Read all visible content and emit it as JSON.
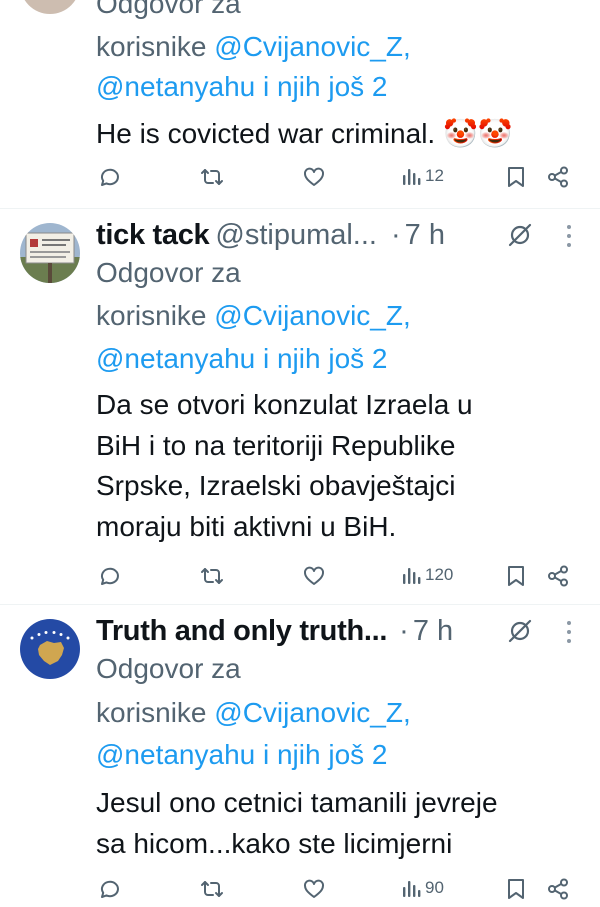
{
  "tweets": [
    {
      "reply_prefix": "Odgovor za",
      "reply_line2_prefix": "korisnike ",
      "mention1": "@Cvijanovic_Z,",
      "mention2": "@netanyahu i njih još 2",
      "text_lines": [
        "He is covicted war criminal. 🤡🤡"
      ],
      "views": "12"
    },
    {
      "author_name": "tick tack",
      "handle": "@stipumal...",
      "separator": "·",
      "time": "7 h",
      "reply_prefix": "Odgovor za",
      "reply_line2_prefix": "korisnike ",
      "mention1": "@Cvijanovic_Z,",
      "mention2": "@netanyahu i njih još 2",
      "text_lines": [
        "Da se otvori konzulat Izraela u",
        "BiH i to na teritoriji Republike",
        "Srpske, Izraelski obavještajci",
        "moraju biti aktivni u BiH."
      ],
      "views": "120"
    },
    {
      "author_name": "Truth and only truth...",
      "separator": "·",
      "time": "7 h",
      "reply_prefix": "Odgovor za",
      "reply_line2_prefix": "korisnike ",
      "mention1": "@Cvijanovic_Z,",
      "mention2": "@netanyahu i njih još 2",
      "text_lines": [
        "Jesul ono cetnici tamanili jevreje",
        "sa hicom...kako ste licimjerni"
      ],
      "views": "90"
    }
  ],
  "icons": {
    "reply": "speech-bubble",
    "retweet": "retweet-arrows",
    "like": "heart-outline",
    "views": "bar-chart",
    "bookmark": "bookmark",
    "share": "share",
    "grok": "slashed-circle",
    "more": "vertical-ellipsis"
  },
  "colors": {
    "text": "#0f1419",
    "secondary": "#536471",
    "link": "#1d9bf0",
    "divider": "#eff3f4",
    "kosovo_flag": "#244aa5",
    "kosovo_map": "#d0a650"
  }
}
